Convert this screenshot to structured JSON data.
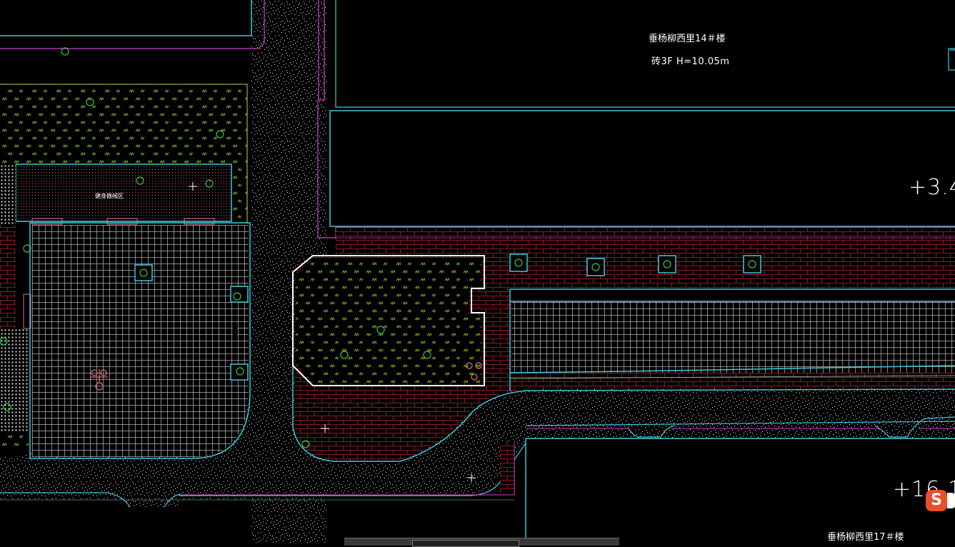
{
  "building_north": {
    "name": "垂杨柳西里14＃楼",
    "info": "砖3F   H=10.05m"
  },
  "building_south": {
    "name": "垂杨柳西里17＃楼"
  },
  "elevations": {
    "north": "+3.4",
    "south": "+16.1"
  },
  "zone_label": "健身器械区",
  "icons": {
    "ime": "sogou-ime-icon",
    "cursor": "crosshair-cursor-icon"
  },
  "colors": {
    "background": "#000000",
    "cyan": "#3ec8d8",
    "magenta": "#d040d0",
    "green": "#40c040",
    "grass": "#7ab020",
    "brick": "#8a1a24",
    "paving_grid": "#cfcfcf",
    "gravel": "#ffffff",
    "white": "#ffffff",
    "tree_pink": "#e07080"
  }
}
